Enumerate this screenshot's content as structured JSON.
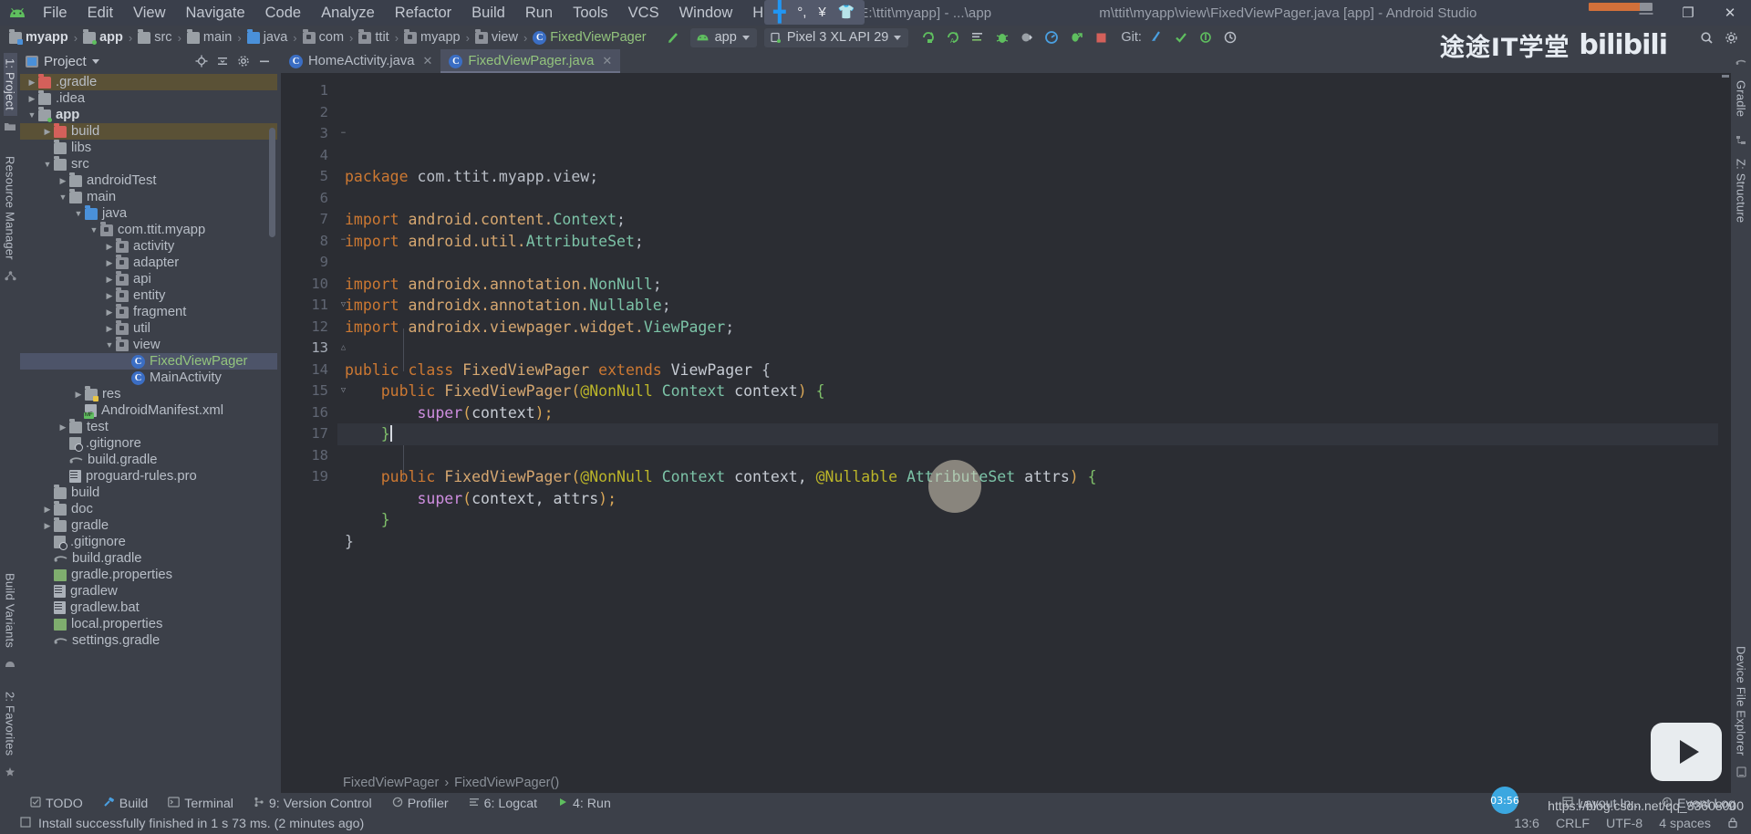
{
  "window": {
    "title_left": "myapp [E:\\ttit\\myapp] - ...\\app",
    "title_right": "m\\ttit\\myapp\\view\\FixedViewPager.java [app] - Android Studio",
    "minimize": "—",
    "maximize": "❐",
    "close": "✕"
  },
  "menu": {
    "items": [
      "File",
      "Edit",
      "View",
      "Navigate",
      "Code",
      "Analyze",
      "Refactor",
      "Build",
      "Run",
      "Tools",
      "VCS",
      "Window",
      "Help"
    ]
  },
  "navbar": {
    "crumbs": [
      {
        "label": "myapp",
        "type": "module-bold"
      },
      {
        "label": "app",
        "type": "module-app"
      },
      {
        "label": "src",
        "type": "folder"
      },
      {
        "label": "main",
        "type": "folder"
      },
      {
        "label": "java",
        "type": "folder-blue"
      },
      {
        "label": "com",
        "type": "package"
      },
      {
        "label": "ttit",
        "type": "package"
      },
      {
        "label": "myapp",
        "type": "package"
      },
      {
        "label": "view",
        "type": "package"
      },
      {
        "label": "FixedViewPager",
        "type": "class"
      }
    ],
    "separator": "›",
    "run_config": "app",
    "device": "Pixel 3 XL API 29",
    "git_label": "Git:",
    "toolbar_icons": [
      "make-project-icon",
      "run-icon",
      "debug-icon",
      "attach-debugger-icon",
      "run-with-coverage-icon",
      "profiler-icon",
      "apply-changes-icon",
      "stop-icon"
    ]
  },
  "project_panel": {
    "title": "Project",
    "actions": [
      "target-icon",
      "collapse-all-icon",
      "settings-gear-icon",
      "hide-icon"
    ],
    "tree": [
      {
        "label": ".gradle",
        "depth": 1,
        "arrow": "collapsed",
        "icon": "folder-red",
        "state": "highlight"
      },
      {
        "label": ".idea",
        "depth": 1,
        "arrow": "collapsed",
        "icon": "folder",
        "state": "normal"
      },
      {
        "label": "app",
        "depth": 1,
        "arrow": "expanded",
        "icon": "module-app",
        "state": "bold"
      },
      {
        "label": "build",
        "depth": 2,
        "arrow": "collapsed",
        "icon": "folder-red",
        "state": "highlight"
      },
      {
        "label": "libs",
        "depth": 2,
        "arrow": "none",
        "icon": "folder",
        "state": "normal"
      },
      {
        "label": "src",
        "depth": 2,
        "arrow": "expanded",
        "icon": "folder",
        "state": "normal"
      },
      {
        "label": "androidTest",
        "depth": 3,
        "arrow": "collapsed",
        "icon": "folder",
        "state": "normal"
      },
      {
        "label": "main",
        "depth": 3,
        "arrow": "expanded",
        "icon": "folder",
        "state": "normal"
      },
      {
        "label": "java",
        "depth": 4,
        "arrow": "expanded",
        "icon": "folder-blue",
        "state": "normal"
      },
      {
        "label": "com.ttit.myapp",
        "depth": 5,
        "arrow": "expanded",
        "icon": "package",
        "state": "normal"
      },
      {
        "label": "activity",
        "depth": 6,
        "arrow": "collapsed",
        "icon": "package",
        "state": "normal"
      },
      {
        "label": "adapter",
        "depth": 6,
        "arrow": "collapsed",
        "icon": "package",
        "state": "normal"
      },
      {
        "label": "api",
        "depth": 6,
        "arrow": "collapsed",
        "icon": "package",
        "state": "normal"
      },
      {
        "label": "entity",
        "depth": 6,
        "arrow": "collapsed",
        "icon": "package",
        "state": "normal"
      },
      {
        "label": "fragment",
        "depth": 6,
        "arrow": "collapsed",
        "icon": "package",
        "state": "normal"
      },
      {
        "label": "util",
        "depth": 6,
        "arrow": "collapsed",
        "icon": "package",
        "state": "normal"
      },
      {
        "label": "view",
        "depth": 6,
        "arrow": "expanded",
        "icon": "package",
        "state": "normal"
      },
      {
        "label": "FixedViewPager",
        "depth": 7,
        "arrow": "none",
        "icon": "class",
        "state": "selected"
      },
      {
        "label": "MainActivity",
        "depth": 7,
        "arrow": "none",
        "icon": "class",
        "state": "normal"
      },
      {
        "label": "res",
        "depth": 4,
        "arrow": "collapsed",
        "icon": "folder-res",
        "state": "normal"
      },
      {
        "label": "AndroidManifest.xml",
        "depth": 4,
        "arrow": "none",
        "icon": "manifest",
        "state": "normal"
      },
      {
        "label": "test",
        "depth": 3,
        "arrow": "collapsed",
        "icon": "folder",
        "state": "normal"
      },
      {
        "label": ".gitignore",
        "depth": 3,
        "arrow": "none",
        "icon": "gitignore",
        "state": "normal"
      },
      {
        "label": "build.gradle",
        "depth": 3,
        "arrow": "none",
        "icon": "gradle",
        "state": "normal"
      },
      {
        "label": "proguard-rules.pro",
        "depth": 3,
        "arrow": "none",
        "icon": "properties",
        "state": "normal"
      },
      {
        "label": "build",
        "depth": 2,
        "arrow": "none",
        "icon": "folder",
        "state": "normal"
      },
      {
        "label": "doc",
        "depth": 2,
        "arrow": "collapsed",
        "icon": "folder",
        "state": "normal"
      },
      {
        "label": "gradle",
        "depth": 2,
        "arrow": "collapsed",
        "icon": "folder",
        "state": "normal"
      },
      {
        "label": ".gitignore",
        "depth": 2,
        "arrow": "none",
        "icon": "gitignore",
        "state": "normal"
      },
      {
        "label": "build.gradle",
        "depth": 2,
        "arrow": "none",
        "icon": "gradle",
        "state": "normal"
      },
      {
        "label": "gradle.properties",
        "depth": 2,
        "arrow": "none",
        "icon": "gradle-props",
        "state": "normal"
      },
      {
        "label": "gradlew",
        "depth": 2,
        "arrow": "none",
        "icon": "properties",
        "state": "normal"
      },
      {
        "label": "gradlew.bat",
        "depth": 2,
        "arrow": "none",
        "icon": "properties",
        "state": "normal"
      },
      {
        "label": "local.properties",
        "depth": 2,
        "arrow": "none",
        "icon": "gradle-props",
        "state": "normal"
      },
      {
        "label": "settings.gradle",
        "depth": 2,
        "arrow": "none",
        "icon": "gradle",
        "state": "normal"
      }
    ]
  },
  "left_rail": {
    "items": [
      "1: Project",
      "Resource Manager",
      "Build Variants",
      "2: Favorites"
    ]
  },
  "right_rail": {
    "items": [
      "Gradle",
      "Z: Structure",
      "Device File Explorer"
    ]
  },
  "editor": {
    "tabs": [
      {
        "label": "HomeActivity.java",
        "active": false,
        "close": "✕"
      },
      {
        "label": "FixedViewPager.java",
        "active": true,
        "close": "✕"
      }
    ],
    "current_line": 13,
    "lines": [
      {
        "n": 1,
        "tokens": [
          {
            "t": "package ",
            "c": "k"
          },
          {
            "t": "com.ttit.myapp.view",
            "c": "pl"
          },
          {
            "t": ";",
            "c": "pl"
          }
        ]
      },
      {
        "n": 2,
        "tokens": []
      },
      {
        "n": 3,
        "tokens": [
          {
            "t": "import ",
            "c": "k"
          },
          {
            "t": "android.content.",
            "c": "s"
          },
          {
            "t": "Context",
            "c": "t"
          },
          {
            "t": ";",
            "c": "pl"
          }
        ],
        "fold": "minus"
      },
      {
        "n": 4,
        "tokens": [
          {
            "t": "import ",
            "c": "k"
          },
          {
            "t": "android.util.",
            "c": "s"
          },
          {
            "t": "AttributeSet",
            "c": "t"
          },
          {
            "t": ";",
            "c": "pl"
          }
        ]
      },
      {
        "n": 5,
        "tokens": []
      },
      {
        "n": 6,
        "tokens": [
          {
            "t": "import ",
            "c": "k"
          },
          {
            "t": "androidx.annotation.",
            "c": "s"
          },
          {
            "t": "NonNull",
            "c": "t"
          },
          {
            "t": ";",
            "c": "pl"
          }
        ]
      },
      {
        "n": 7,
        "tokens": [
          {
            "t": "import ",
            "c": "k"
          },
          {
            "t": "androidx.annotation.",
            "c": "s"
          },
          {
            "t": "Nullable",
            "c": "t"
          },
          {
            "t": ";",
            "c": "pl"
          }
        ]
      },
      {
        "n": 8,
        "tokens": [
          {
            "t": "import ",
            "c": "k"
          },
          {
            "t": "androidx.viewpager.widget.",
            "c": "s"
          },
          {
            "t": "ViewPager",
            "c": "t"
          },
          {
            "t": ";",
            "c": "pl"
          }
        ],
        "fold": "minus"
      },
      {
        "n": 9,
        "tokens": []
      },
      {
        "n": 10,
        "tokens": [
          {
            "t": "public class ",
            "c": "k"
          },
          {
            "t": "FixedViewPager",
            "c": "s"
          },
          {
            "t": " extends ",
            "c": "k"
          },
          {
            "t": "ViewPager",
            "c": "w"
          },
          {
            "t": " {",
            "c": "pl"
          }
        ]
      },
      {
        "n": 11,
        "tokens": [
          {
            "t": "    public ",
            "c": "k"
          },
          {
            "t": "FixedViewPager",
            "c": "s"
          },
          {
            "t": "(",
            "c": "p"
          },
          {
            "t": "@NonNull ",
            "c": "an"
          },
          {
            "t": "Context",
            "c": "t"
          },
          {
            "t": " context",
            "c": "w"
          },
          {
            "t": ")",
            "c": "p"
          },
          {
            "t": " {",
            "c": "br"
          }
        ],
        "fold": "plus"
      },
      {
        "n": 12,
        "tokens": [
          {
            "t": "        ",
            "c": "pl"
          },
          {
            "t": "super",
            "c": "kw"
          },
          {
            "t": "(",
            "c": "p"
          },
          {
            "t": "context",
            "c": "w"
          },
          {
            "t": ")",
            "c": "p"
          },
          {
            "t": ";",
            "c": "p"
          }
        ]
      },
      {
        "n": 13,
        "tokens": [
          {
            "t": "    ",
            "c": "pl"
          },
          {
            "t": "}",
            "c": "br"
          }
        ],
        "fold": "end"
      },
      {
        "n": 14,
        "tokens": []
      },
      {
        "n": 15,
        "tokens": [
          {
            "t": "    public ",
            "c": "k"
          },
          {
            "t": "FixedViewPager",
            "c": "s"
          },
          {
            "t": "(",
            "c": "p"
          },
          {
            "t": "@NonNull ",
            "c": "an"
          },
          {
            "t": "Context",
            "c": "t"
          },
          {
            "t": " context, ",
            "c": "w"
          },
          {
            "t": "@Nullable ",
            "c": "an"
          },
          {
            "t": "AttributeSet",
            "c": "t"
          },
          {
            "t": " attrs",
            "c": "w"
          },
          {
            "t": ")",
            "c": "p"
          },
          {
            "t": " {",
            "c": "br"
          }
        ],
        "fold": "plus"
      },
      {
        "n": 16,
        "tokens": [
          {
            "t": "        ",
            "c": "pl"
          },
          {
            "t": "super",
            "c": "kw"
          },
          {
            "t": "(",
            "c": "p"
          },
          {
            "t": "context, attrs",
            "c": "w"
          },
          {
            "t": ")",
            "c": "p"
          },
          {
            "t": ";",
            "c": "p"
          }
        ]
      },
      {
        "n": 17,
        "tokens": [
          {
            "t": "    ",
            "c": "pl"
          },
          {
            "t": "}",
            "c": "br"
          }
        ],
        "fold": "end"
      },
      {
        "n": 18,
        "tokens": [
          {
            "t": "}",
            "c": "pl"
          }
        ]
      },
      {
        "n": 19,
        "tokens": []
      }
    ],
    "breadcrumb": [
      "FixedViewPager",
      "FixedViewPager()"
    ],
    "breadcrumb_sep": "›"
  },
  "bottom_bar": {
    "items": [
      {
        "label": "TODO",
        "icon": "checklist-icon"
      },
      {
        "label": "Build",
        "icon": "hammer-icon"
      },
      {
        "label": "Terminal",
        "icon": "terminal-icon"
      },
      {
        "label": "9: Version Control",
        "icon": "branch-icon"
      },
      {
        "label": "Profiler",
        "icon": "profiler-icon"
      },
      {
        "label": "6: Logcat",
        "icon": "logcat-icon"
      },
      {
        "label": "4: Run",
        "icon": "run-icon"
      }
    ],
    "right_items": [
      {
        "label": "Layout In...",
        "icon": "layout-inspector-icon"
      },
      {
        "label": "Event Log",
        "icon": "event-log-icon"
      }
    ]
  },
  "statusbar": {
    "message": "Install successfully finished in 1 s 73 ms. (2 minutes ago)",
    "caret": "13:6",
    "line_sep": "CRLF",
    "encoding": "UTF-8",
    "indent": "4 spaces",
    "lock_icon": "lock-icon"
  },
  "watermark": {
    "cn_text": "途途IT学堂",
    "bili_text": "bilibili",
    "url": "https://blog.csdn.net/qq_33608000",
    "timer": "03:56"
  },
  "colors": {
    "accent_green": "#93c47d",
    "selection_blue": "#4d5469",
    "keyword_orange": "#cc7832",
    "string_yellow": "#d6a770",
    "type_teal": "#7cc3a7",
    "annotation_olive": "#bbb529"
  }
}
